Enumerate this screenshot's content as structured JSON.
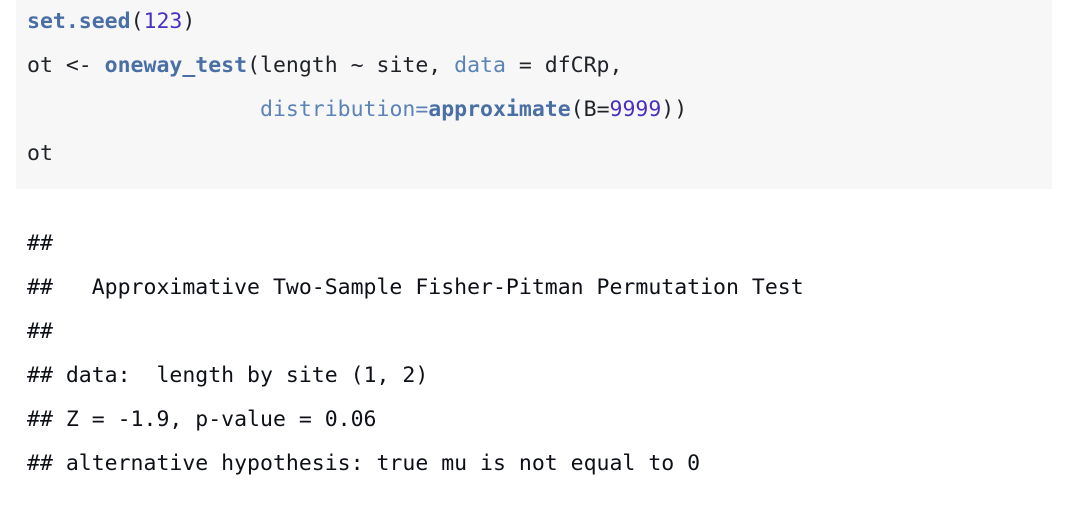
{
  "document": {
    "type": "r-markdown-console-output",
    "colors": {
      "code_background": "#f7f7f8",
      "page_background": "#ffffff",
      "function_token": "#4a6fa5",
      "argument_token": "#5b83b8",
      "number_token": "#4a2fc0",
      "plain_text": "#1f2328"
    }
  },
  "code_chunk": {
    "language": "R",
    "lines": [
      {
        "id": "line-1",
        "tokens": [
          {
            "text": "set.seed",
            "type": "fn"
          },
          {
            "text": "(",
            "type": "plain"
          },
          {
            "text": "123",
            "type": "num"
          },
          {
            "text": ")",
            "type": "plain"
          }
        ],
        "plain": "set.seed(123)"
      },
      {
        "id": "line-2",
        "tokens": [
          {
            "text": "ot <- ",
            "type": "plain"
          },
          {
            "text": "oneway_test",
            "type": "fn"
          },
          {
            "text": "(length ~ site, ",
            "type": "plain"
          },
          {
            "text": "data",
            "type": "arg"
          },
          {
            "text": " = dfCRp,",
            "type": "plain"
          }
        ],
        "plain": "ot <- oneway_test(length ~ site, data = dfCRp,"
      },
      {
        "id": "line-3",
        "tokens": [
          {
            "text": "                  ",
            "type": "plain"
          },
          {
            "text": "distribution=",
            "type": "arg"
          },
          {
            "text": "approximate",
            "type": "fn"
          },
          {
            "text": "(",
            "type": "plain"
          },
          {
            "text": "B=",
            "type": "plain"
          },
          {
            "text": "9999",
            "type": "num"
          },
          {
            "text": "))",
            "type": "plain"
          }
        ],
        "plain": "                  distribution=approximate(B=9999))"
      },
      {
        "id": "line-4",
        "tokens": [
          {
            "text": "ot",
            "type": "plain"
          }
        ],
        "plain": "ot"
      }
    ]
  },
  "console_output": {
    "prefix": "##",
    "lines": [
      {
        "id": "out-1",
        "text": "## "
      },
      {
        "id": "out-2",
        "text": "##   Approximative Two-Sample Fisher-Pitman Permutation Test"
      },
      {
        "id": "out-3",
        "text": "## "
      },
      {
        "id": "out-4",
        "text": "## data:  length by site (1, 2)"
      },
      {
        "id": "out-5",
        "text": "## Z = -1.9, p-value = 0.06"
      },
      {
        "id": "out-6",
        "text": "## alternative hypothesis: true mu is not equal to 0"
      }
    ],
    "test_name": "Approximative Two-Sample Fisher-Pitman Permutation Test",
    "data_description": "length by site (1, 2)",
    "statistic_label": "Z",
    "statistic_value": "-1.9",
    "p_value_label": "p-value",
    "p_value": "0.06",
    "alternative_hypothesis": "true mu is not equal to 0"
  }
}
